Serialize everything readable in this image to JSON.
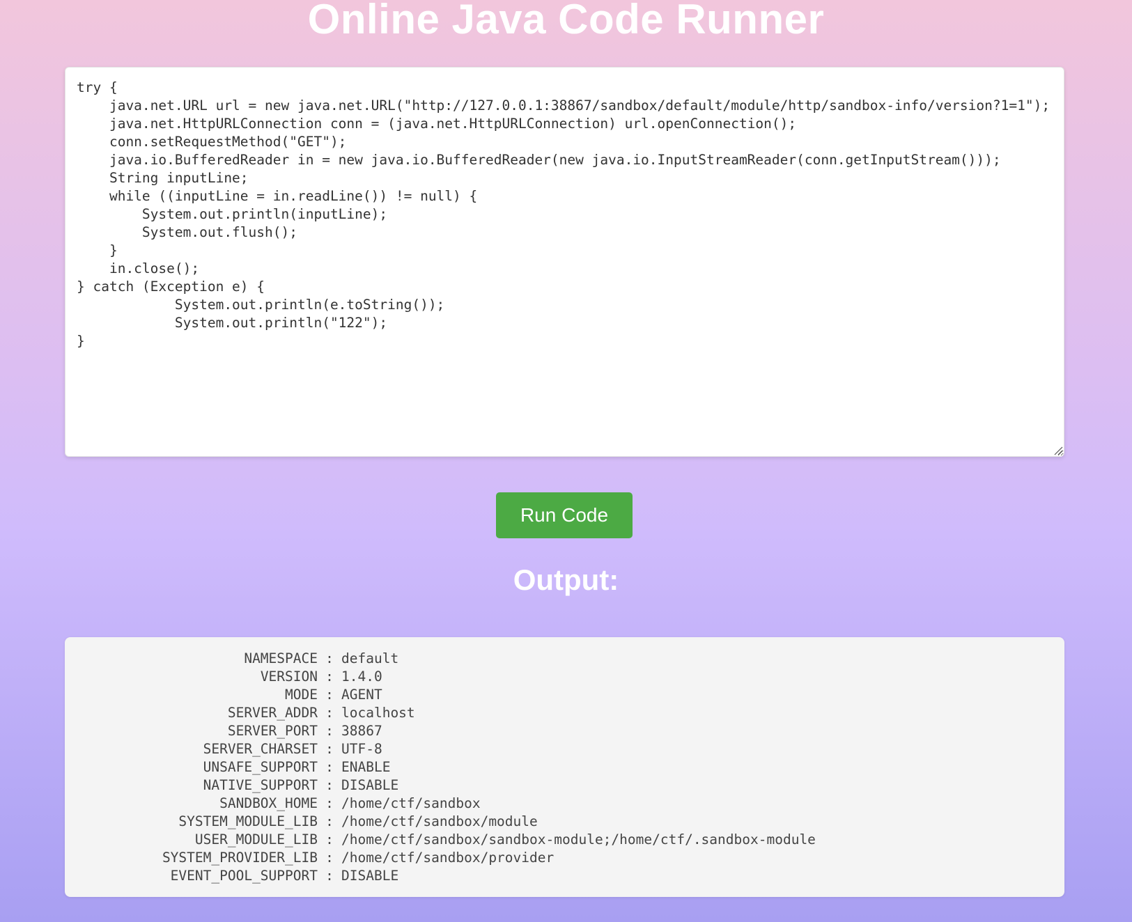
{
  "page": {
    "title": "Online Java Code Runner"
  },
  "editor": {
    "code": "try {\n    java.net.URL url = new java.net.URL(\"http://127.0.0.1:38867/sandbox/default/module/http/sandbox-info/version?1=1\");\n    java.net.HttpURLConnection conn = (java.net.HttpURLConnection) url.openConnection();\n    conn.setRequestMethod(\"GET\");\n    java.io.BufferedReader in = new java.io.BufferedReader(new java.io.InputStreamReader(conn.getInputStream()));\n    String inputLine;\n    while ((inputLine = in.readLine()) != null) {\n        System.out.println(inputLine);\n        System.out.flush();\n    }\n    in.close();\n} catch (Exception e) {\n            System.out.println(e.toString());\n            System.out.println(\"122\");\n}"
  },
  "run_button": {
    "label": "Run Code"
  },
  "output": {
    "heading": "Output:",
    "separator": ":",
    "rows": [
      {
        "key": "NAMESPACE",
        "value": "default"
      },
      {
        "key": "VERSION",
        "value": "1.4.0"
      },
      {
        "key": "MODE",
        "value": "AGENT"
      },
      {
        "key": "SERVER_ADDR",
        "value": "localhost"
      },
      {
        "key": "SERVER_PORT",
        "value": "38867"
      },
      {
        "key": "SERVER_CHARSET",
        "value": "UTF-8"
      },
      {
        "key": "UNSAFE_SUPPORT",
        "value": "ENABLE"
      },
      {
        "key": "NATIVE_SUPPORT",
        "value": "DISABLE"
      },
      {
        "key": "SANDBOX_HOME",
        "value": "/home/ctf/sandbox"
      },
      {
        "key": "SYSTEM_MODULE_LIB",
        "value": "/home/ctf/sandbox/module"
      },
      {
        "key": "USER_MODULE_LIB",
        "value": "/home/ctf/sandbox/sandbox-module;/home/ctf/.sandbox-module"
      },
      {
        "key": "SYSTEM_PROVIDER_LIB",
        "value": "/home/ctf/sandbox/provider"
      },
      {
        "key": "EVENT_POOL_SUPPORT",
        "value": "DISABLE"
      }
    ]
  }
}
